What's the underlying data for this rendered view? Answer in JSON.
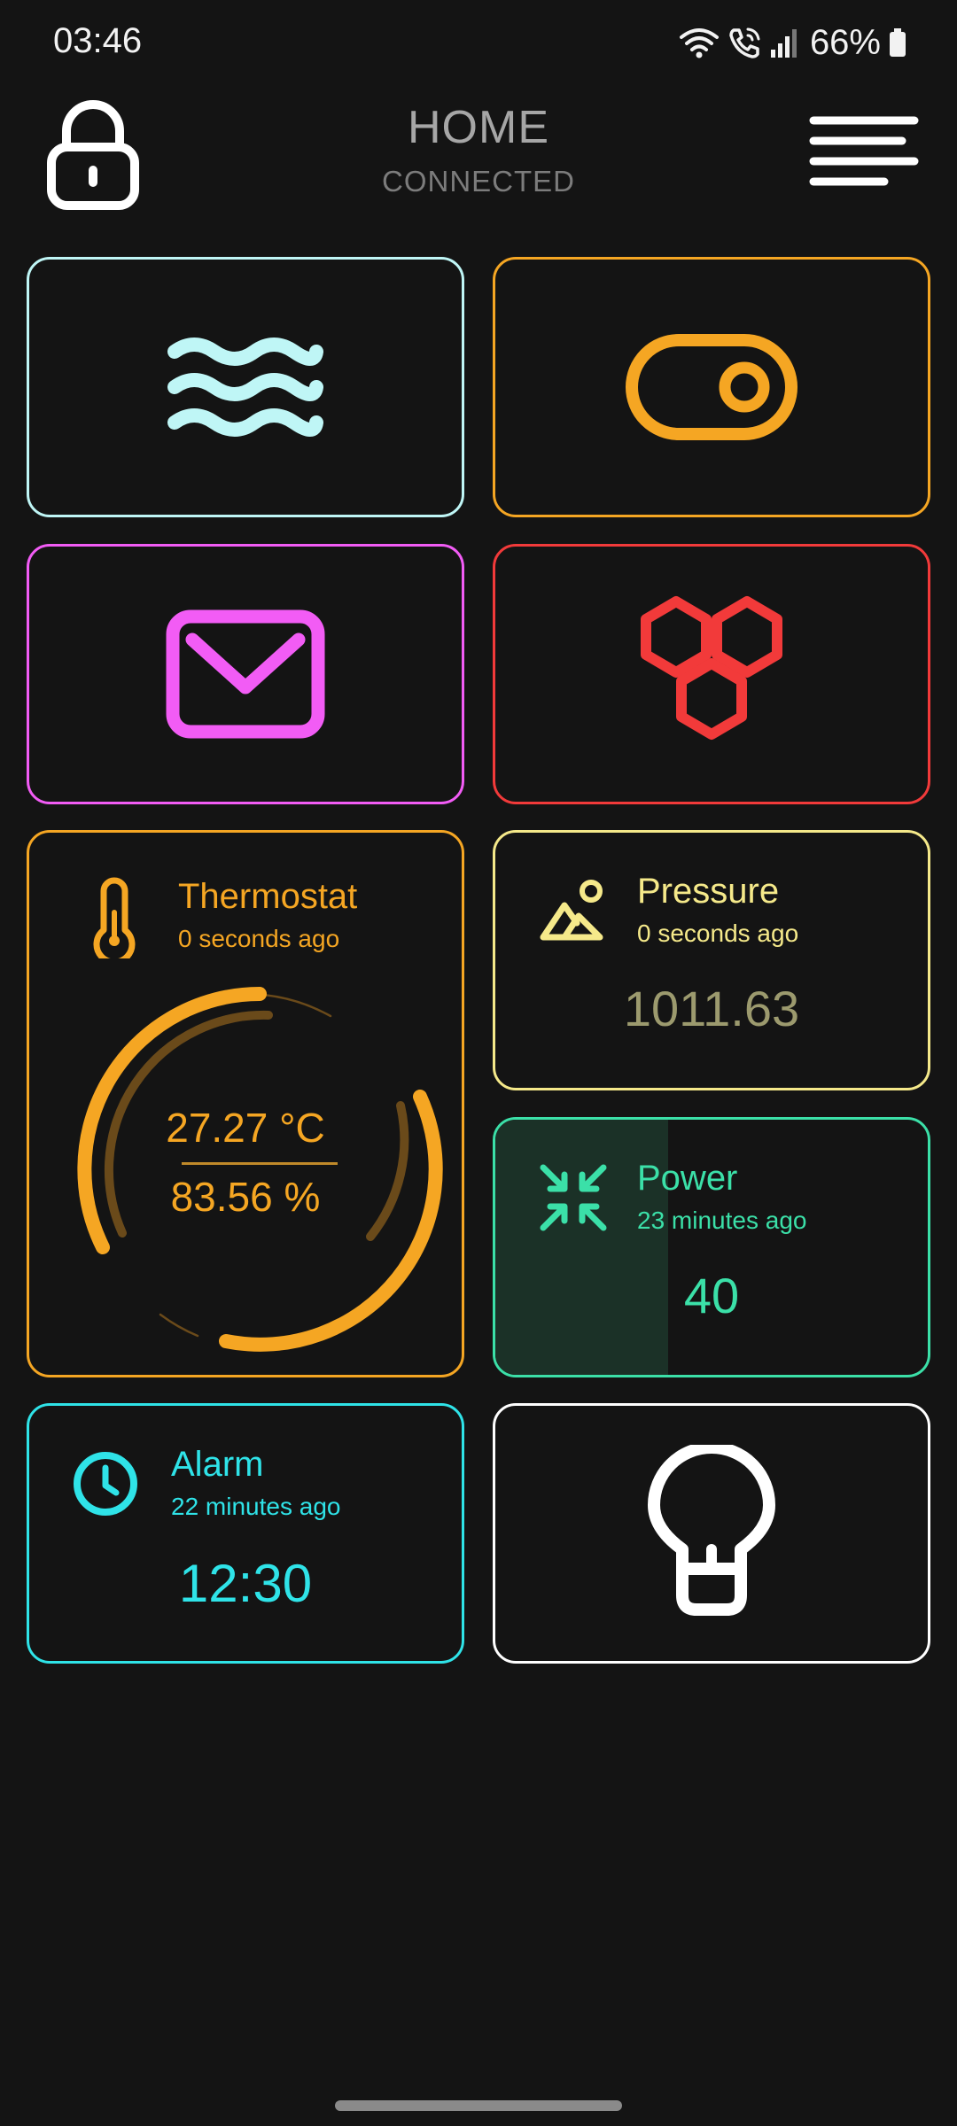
{
  "status_bar": {
    "time": "03:46",
    "battery": "66%"
  },
  "header": {
    "title": "HOME",
    "subtitle": "CONNECTED"
  },
  "colors": {
    "background": "#141414",
    "water": "#bff6f6",
    "switch": "#f5a623",
    "mail": "#f25cf5",
    "hexagon": "#f23a3a",
    "thermostat": "#f5a623",
    "pressure": "#f5e98a",
    "power": "#3be0a8",
    "alarm": "#2fe3e8",
    "light": "#ffffff"
  },
  "tiles": {
    "water": {
      "icon": "waves-icon"
    },
    "switch": {
      "icon": "toggle-switch-icon"
    },
    "mail": {
      "icon": "envelope-icon"
    },
    "hexagon": {
      "icon": "hexagons-icon"
    },
    "light": {
      "icon": "lightbulb-icon"
    }
  },
  "thermostat": {
    "name": "Thermostat",
    "updated": "0 seconds ago",
    "temperature": "27.27 °C",
    "humidity": "83.56 %",
    "icon": "thermometer-icon"
  },
  "pressure": {
    "name": "Pressure",
    "updated": "0 seconds ago",
    "value": "1011.63",
    "icon": "mountains-icon"
  },
  "power": {
    "name": "Power",
    "updated": "23 minutes ago",
    "value": "40",
    "level_percent": 40,
    "icon": "compress-arrows-icon"
  },
  "alarm": {
    "name": "Alarm",
    "updated": "22 minutes ago",
    "value": "12:30",
    "icon": "clock-icon"
  }
}
